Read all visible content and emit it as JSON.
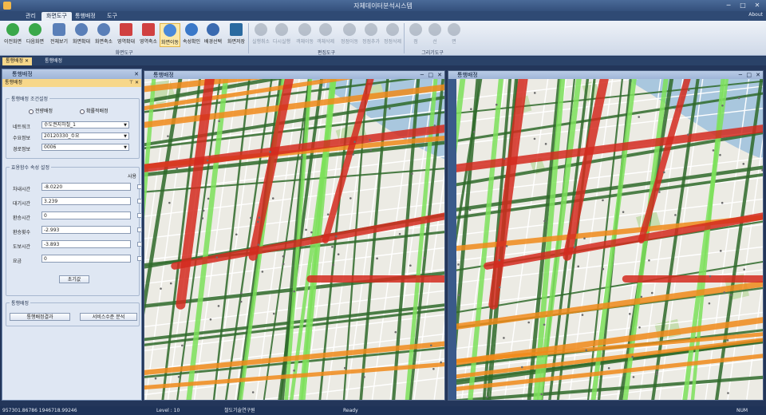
{
  "app": {
    "title": "자체데이터분석시스템"
  },
  "menu": {
    "tabs": [
      "관리",
      "화면도구",
      "통행배정",
      "도구"
    ],
    "about": "About"
  },
  "ribbon": {
    "buttons": [
      {
        "label": "이전화면",
        "color": "#3aa84a"
      },
      {
        "label": "다음화면",
        "color": "#3aa84a"
      },
      {
        "label": "전체보기",
        "color": "#5a7fb8"
      },
      {
        "label": "화면확대",
        "color": "#5a7fb8"
      },
      {
        "label": "화면축소",
        "color": "#5a7fb8"
      },
      {
        "label": "영역확대",
        "color": "#d04040"
      },
      {
        "label": "영역축소",
        "color": "#d04040"
      },
      {
        "label": "화면이동",
        "color": "#4a88d8"
      },
      {
        "label": "속성확인",
        "color": "#3a78c8"
      },
      {
        "label": "배경선택",
        "color": "#3a6ab0"
      },
      {
        "label": "화면저장",
        "color": "#2a6aa0"
      }
    ],
    "edit_buttons": [
      "실행취소",
      "다시실행",
      "객체이동",
      "객체삭제",
      "정점이동",
      "정점추가",
      "정점삭제"
    ],
    "draw_buttons": [
      "점",
      "선",
      "면"
    ],
    "groups": [
      "화면도구",
      "편집도구",
      "그리기도구"
    ]
  },
  "doctabs": [
    "통행배정",
    "통행배정"
  ],
  "left_panel": {
    "window_title": "통행배정",
    "sub_title": "통행배정",
    "condition_section": "통행배정 조건설정",
    "radio_options": [
      "전량배정",
      "확률적배정"
    ],
    "fields": [
      {
        "label": "네트워크",
        "value": "수도권지하철_1"
      },
      {
        "label": "수요정보",
        "value": "20120330_수요"
      },
      {
        "label": "경로정보",
        "value": "0006"
      }
    ],
    "param_section": "효용함수 속성 설정",
    "use_label": "사용",
    "params": [
      {
        "label": "차내시간",
        "value": "-8.0220"
      },
      {
        "label": "대기시간",
        "value": "3.239"
      },
      {
        "label": "환승시간",
        "value": "0"
      },
      {
        "label": "환승횟수",
        "value": "-2.993"
      },
      {
        "label": "도보시간",
        "value": "-3.893"
      },
      {
        "label": "요금",
        "value": "0"
      }
    ],
    "reset_button": "초기값",
    "action_section": "통행배정",
    "action_buttons": [
      "통행배정결과",
      "서비스수준 분석"
    ]
  },
  "map_windows": [
    {
      "title": "통행배정",
      "colors": {
        "heavy": "#d42a1e",
        "medium": "#f08a1a",
        "light": "#7ce05a",
        "dark": "#2f6a2a"
      }
    },
    {
      "title": "통행배정"
    }
  ],
  "status": {
    "coords": "957301.86786 1946718.99246",
    "level": "Level : 10",
    "org": "철도기술연구원",
    "ready": "Ready",
    "num": "NUM"
  }
}
